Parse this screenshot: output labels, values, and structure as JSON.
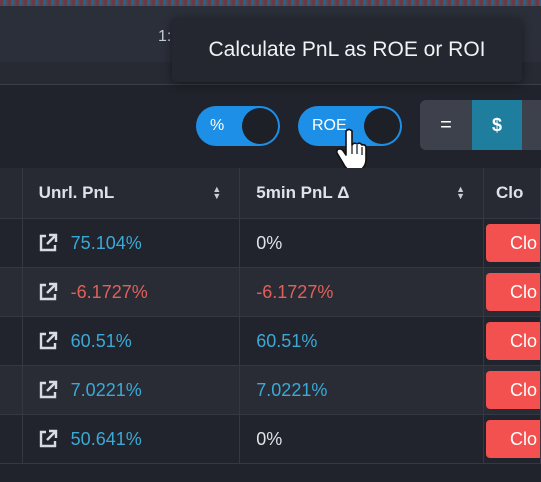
{
  "topbar": {
    "partial_text": "1:"
  },
  "tooltip": {
    "text": "Calculate PnL as ROE or ROI"
  },
  "toolbar": {
    "percent_toggle_label": "%",
    "roe_toggle_label": "ROE",
    "seg_equals": "=",
    "seg_dollar": "$"
  },
  "table": {
    "headers": [
      "Unrl. PnL",
      "5min PnL Δ",
      "Clo"
    ],
    "rows": [
      {
        "pnl": "75.104%",
        "delta": "0%",
        "close": "Clo"
      },
      {
        "pnl": "-6.1727%",
        "delta": "-6.1727%",
        "close": "Clo"
      },
      {
        "pnl": "60.51%",
        "delta": "60.51%",
        "close": "Clo"
      },
      {
        "pnl": "7.0221%",
        "delta": "7.0221%",
        "close": "Clo"
      },
      {
        "pnl": "50.641%",
        "delta": "0%",
        "close": "Clo"
      }
    ]
  },
  "colors": {
    "positive": "#3aa9d6",
    "negative": "#e0605a",
    "toggle_on": "#1e8fe6",
    "close_button": "#f2514f"
  }
}
